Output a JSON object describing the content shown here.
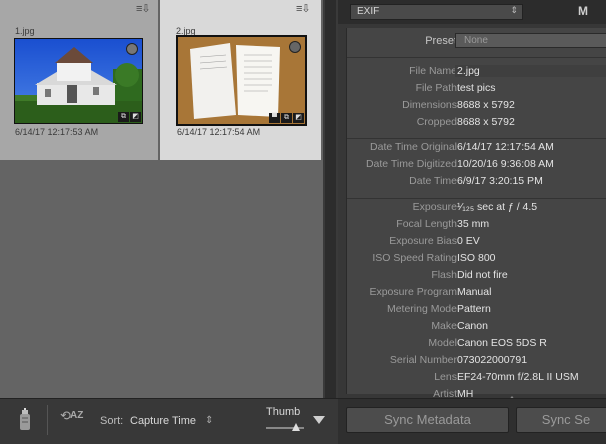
{
  "grid": {
    "cells": [
      {
        "filename": "1.jpg",
        "timestamp": "6/14/17 12:17:53 AM",
        "selected": false
      },
      {
        "filename": "2.jpg",
        "timestamp": "6/14/17 12:17:54 AM",
        "selected": true
      }
    ]
  },
  "toolbar": {
    "sort_label": "Sort:",
    "sort_value": "Capture Time",
    "sort_caret": "⇕",
    "thumb_label": "Thumb",
    "az_label": "AZ"
  },
  "metadata": {
    "panel_select": "EXIF",
    "panel_m_label": "M",
    "preset_label": "Preset",
    "preset_value": "None",
    "rows_group1": [
      {
        "key": "File Name",
        "value": "2.jpg"
      },
      {
        "key": "File Path",
        "value": "test pics"
      },
      {
        "key": "Dimensions",
        "value": "8688 x 5792"
      },
      {
        "key": "Cropped",
        "value": "8688 x 5792"
      }
    ],
    "rows_group2": [
      {
        "key": "Date Time Original",
        "value": "6/14/17 12:17:54 AM"
      },
      {
        "key": "Date Time Digitized",
        "value": "10/20/16 9:36:08 AM"
      },
      {
        "key": "Date Time",
        "value": "6/9/17 3:20:15 PM"
      }
    ],
    "rows_group3": [
      {
        "key": "Exposure",
        "value": "¹⁄₁₂₅ sec at ƒ / 4.5"
      },
      {
        "key": "Focal Length",
        "value": "35 mm"
      },
      {
        "key": "Exposure Bias",
        "value": "0 EV"
      },
      {
        "key": "ISO Speed Rating",
        "value": "ISO 800"
      },
      {
        "key": "Flash",
        "value": "Did not fire"
      },
      {
        "key": "Exposure Program",
        "value": "Manual"
      },
      {
        "key": "Metering Mode",
        "value": "Pattern"
      },
      {
        "key": "Make",
        "value": "Canon"
      },
      {
        "key": "Model",
        "value": "Canon EOS 5DS R"
      },
      {
        "key": "Serial Number",
        "value": "073022000791"
      },
      {
        "key": "Lens",
        "value": "EF24-70mm f/2.8L II USM"
      },
      {
        "key": "Artist",
        "value": "MH"
      }
    ],
    "sync_metadata_label": "Sync Metadata",
    "sync_settings_label": "Sync Se"
  }
}
